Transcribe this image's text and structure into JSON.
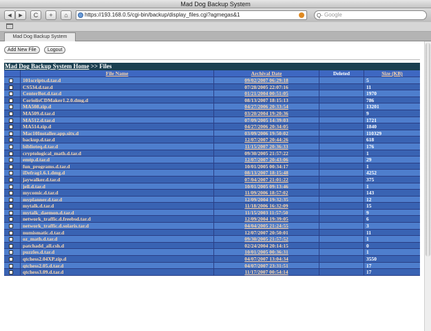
{
  "window": {
    "title": "Mad Dog Backup System"
  },
  "browser": {
    "url": "https://193.168.0.5/cgi-bin/backup/display_files.cgi?agmegas&1",
    "search_placeholder": "Google",
    "tab_label": "Mad Dog Backup System",
    "search_engine_glyph": "Q·",
    "nav_icons": {
      "back": "◄",
      "forward": "►",
      "reload": "C",
      "add": "+",
      "home": "⌂"
    }
  },
  "page": {
    "add_new_file_label": "Add New File",
    "logout_label": "Logout",
    "breadcrumb_link": "Mad Dog Backup System Home",
    "breadcrumb_rest": " >> Files",
    "columns": {
      "name": "File Name",
      "date": "Archival Date",
      "deleted": "Deleted",
      "size": "Size (KB)"
    },
    "files": [
      {
        "name": "101scripts.d.tar.d",
        "date": "09/02/2007 06:29:18",
        "deleted": "",
        "size": "5"
      },
      {
        "name": "CS534.d.tar.d",
        "date": "07/28/2005 22:07:16",
        "deleted": "",
        "size": "11"
      },
      {
        "name": "CenterBot.d.tar.d",
        "date": "01/21/2004 00:51:05",
        "deleted": "",
        "size": "1970"
      },
      {
        "name": "CoriolisCDMaker1.2.0.dmg.d",
        "date": "08/13/2007 18:15:13",
        "deleted": "",
        "size": "786"
      },
      {
        "name": "MA508.zip.d",
        "date": "04/27/2006 20:33:54",
        "deleted": "",
        "size": "13201"
      },
      {
        "name": "MA509.d.tar.d",
        "date": "03/20/2004 19:20:36",
        "deleted": "",
        "size": "9"
      },
      {
        "name": "MA512.d.tar.d",
        "date": "07/09/2005 14:39:03",
        "deleted": "",
        "size": "1721"
      },
      {
        "name": "MA514.zip.d",
        "date": "04/27/2006 20:34:05",
        "deleted": "",
        "size": "1840"
      },
      {
        "name": "Mac10Installer.app.sitx.d",
        "date": "03/09/2006 19:50:02",
        "deleted": "",
        "size": "110329"
      },
      {
        "name": "backup.d.tar.d",
        "date": "12/07/2007 20:44:26",
        "deleted": "",
        "size": "618"
      },
      {
        "name": "biblioteq.d.tar.d",
        "date": "11/15/2007 20:36:33",
        "deleted": "",
        "size": "176"
      },
      {
        "name": "cryptological_math.d.tar.d",
        "date": "09/30/2005 21:57:22",
        "deleted": "",
        "size": "1"
      },
      {
        "name": "emtp.d.tar.d",
        "date": "12/07/2007 20:43:06",
        "deleted": "",
        "size": "29"
      },
      {
        "name": "fun_programs.d.tar.d",
        "date": "10/01/2005 00:34:17",
        "deleted": "",
        "size": "1"
      },
      {
        "name": "iDefrag1.6.1.dmg.d",
        "date": "08/13/2007 18:15:48",
        "deleted": "",
        "size": "4252"
      },
      {
        "name": "jaywalker.d.tar.d",
        "date": "07/04/2007 21:01:22",
        "deleted": "",
        "size": "375"
      },
      {
        "name": "jell.d.tar.d",
        "date": "10/01/2005 09:13:46",
        "deleted": "",
        "size": "1"
      },
      {
        "name": "mycomic.d.tar.d",
        "date": "11/09/2006 18:57:02",
        "deleted": "",
        "size": "143"
      },
      {
        "name": "myplanner.d.tar.d",
        "date": "12/09/2004 19:32:35",
        "deleted": "",
        "size": "12"
      },
      {
        "name": "mytalk.d.tar.d",
        "date": "11/18/2006 16:32:09",
        "deleted": "",
        "size": "15"
      },
      {
        "name": "mytalk_daemon.d.tar.d",
        "date": "11/15/2003 11:57:50",
        "deleted": "",
        "size": "9"
      },
      {
        "name": "network_traffic.d.freebsd.tar.d",
        "date": "12/09/2004 19:39:05",
        "deleted": "",
        "size": "6"
      },
      {
        "name": "network_traffic.d.solaris.tar.d",
        "date": "04/04/2005 21:24:55",
        "deleted": "",
        "size": "3"
      },
      {
        "name": "numismatic.d.tar.d",
        "date": "12/07/2007 20:50:01",
        "deleted": "",
        "size": "11"
      },
      {
        "name": "oz_math.d.tar.d",
        "date": "09/30/2005 21:57:52",
        "deleted": "",
        "size": "1"
      },
      {
        "name": "patchadd_all.csh.d",
        "date": "02/24/2004 20:14:15",
        "deleted": "",
        "size": "0"
      },
      {
        "name": "puzzles.d.tar.d",
        "date": "10/01/2005 00:36:31",
        "deleted": "",
        "size": "1"
      },
      {
        "name": "qtchess2.04XP.zip.d",
        "date": "04/07/2007 13:04:34",
        "deleted": "",
        "size": "3550"
      },
      {
        "name": "qtchess2.05.d.tar.d",
        "date": "04/07/2007 23:31:51",
        "deleted": "",
        "size": "17"
      },
      {
        "name": "qtchess3.09.d.tar.d",
        "date": "11/17/2007 00:54:14",
        "deleted": "",
        "size": "17"
      }
    ]
  }
}
